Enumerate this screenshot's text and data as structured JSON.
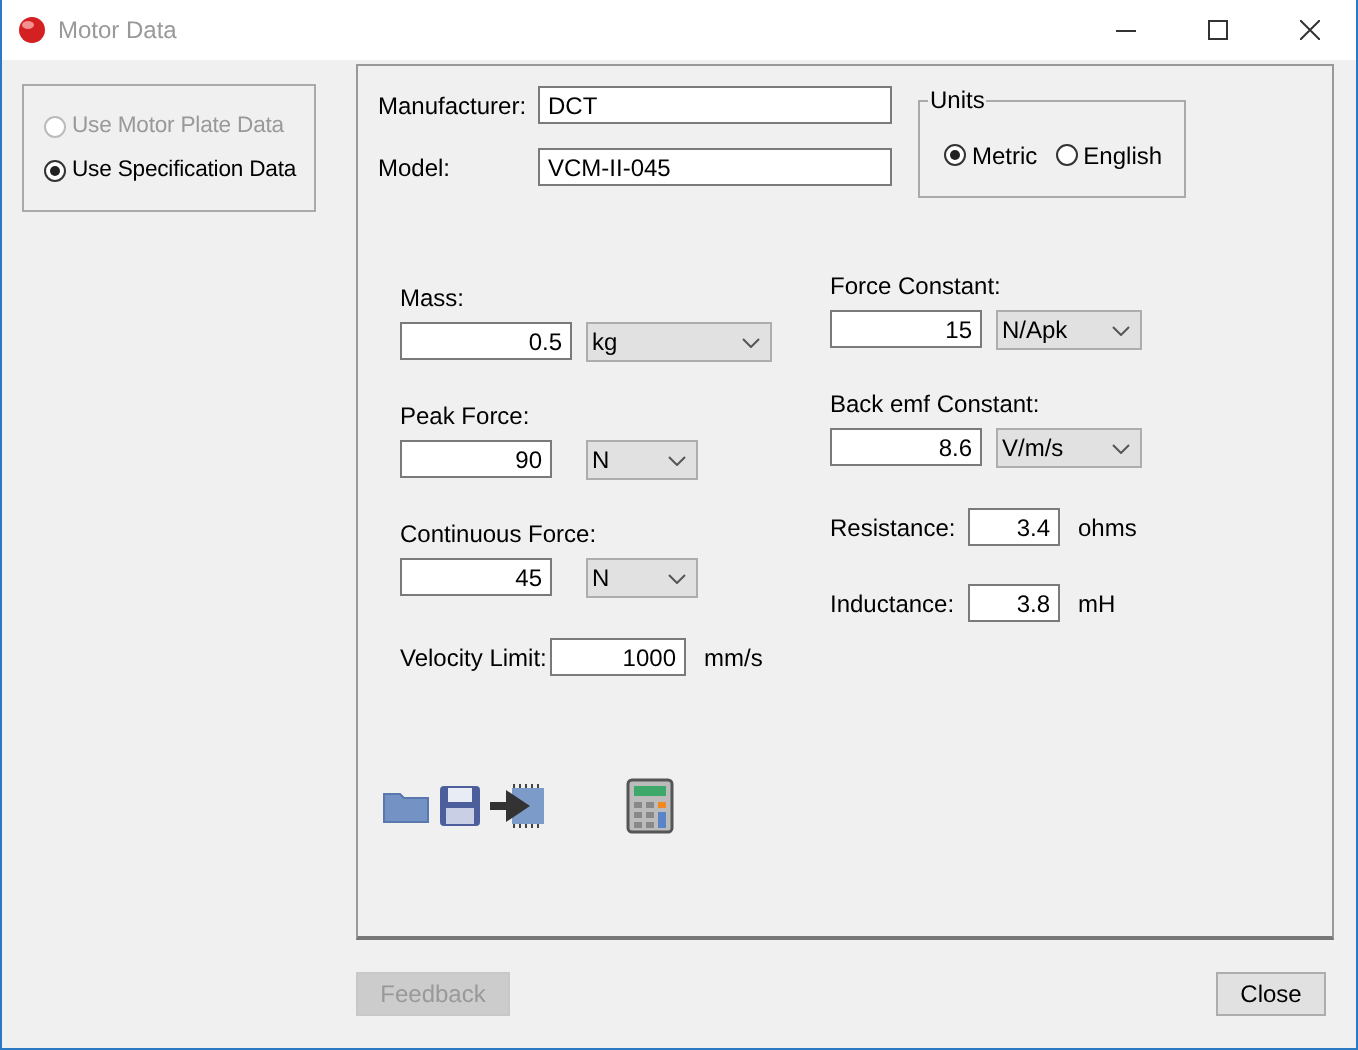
{
  "window": {
    "title": "Motor Data"
  },
  "data_source": [
    {
      "label": "Use Motor Plate Data",
      "selected": false,
      "disabled": true
    },
    {
      "label": "Use Specification Data",
      "selected": true,
      "disabled": false
    }
  ],
  "identity": [
    {
      "label": "Manufacturer:",
      "value": "DCT"
    },
    {
      "label": "Model:",
      "value": "VCM-II-045"
    }
  ],
  "units": {
    "title": "Units",
    "options": [
      {
        "label": "Metric",
        "selected": true
      },
      {
        "label": "English",
        "selected": false
      }
    ]
  },
  "left_params": [
    {
      "kind": "select",
      "label": "Mass:",
      "value": "0.5",
      "unit": "kg"
    },
    {
      "kind": "select",
      "label": "Peak Force:",
      "value": "90",
      "unit": "N"
    },
    {
      "kind": "select",
      "label": "Continuous Force:",
      "value": "45",
      "unit": "N"
    },
    {
      "kind": "inline",
      "label": "Velocity Limit:",
      "value": "1000",
      "unit": "mm/s"
    }
  ],
  "right_params": [
    {
      "kind": "select",
      "label": "Force Constant:",
      "value": "15",
      "unit": "N/Apk"
    },
    {
      "kind": "select",
      "label": "Back emf Constant:",
      "value": "8.6",
      "unit": "V/m/s"
    },
    {
      "kind": "inline",
      "label": "Resistance:",
      "value": "3.4",
      "unit": "ohms"
    },
    {
      "kind": "inline",
      "label": "Inductance:",
      "value": "3.8",
      "unit": "mH"
    }
  ],
  "buttons": [
    {
      "label": "Feedback",
      "disabled": true
    },
    {
      "label": "Close",
      "disabled": false
    }
  ]
}
